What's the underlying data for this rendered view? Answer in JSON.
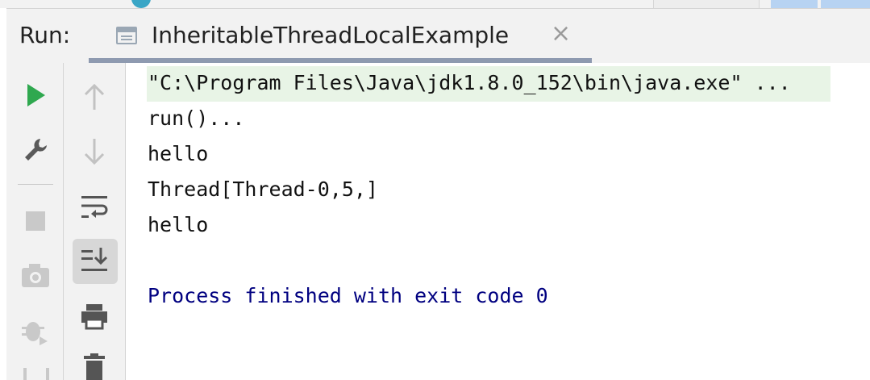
{
  "run_panel": {
    "label": "Run:",
    "tab": {
      "title": "InheritableThreadLocalExample",
      "close_glyph": "×",
      "icon": "console-window-icon"
    }
  },
  "left_toolbar": {
    "items": [
      {
        "name": "rerun-icon",
        "color": "#2fa84f"
      },
      {
        "name": "wrench-icon",
        "color": "#5a5a5a"
      },
      {
        "name": "stop-icon",
        "color": "#c9c9c9"
      },
      {
        "name": "camera-icon",
        "color": "#c9c9c9"
      },
      {
        "name": "debug-bug-icon",
        "color": "#c9c9c9"
      }
    ]
  },
  "console_toolbar": {
    "items": [
      {
        "name": "up-arrow-icon"
      },
      {
        "name": "down-arrow-icon"
      },
      {
        "name": "soft-wrap-icon"
      },
      {
        "name": "scroll-to-end-icon",
        "selected": true
      },
      {
        "name": "print-icon"
      },
      {
        "name": "trash-icon"
      }
    ]
  },
  "console": {
    "lines": [
      "\"C:\\Program Files\\Java\\jdk1.8.0_152\\bin\\java.exe\" ...",
      "run()...",
      "hello",
      "Thread[Thread-0,5,]",
      "hello",
      "",
      "Process finished with exit code 0"
    ],
    "colors": {
      "command_bg": "#e8f4e6",
      "output": "#111111",
      "exit_message": "#000080"
    }
  }
}
